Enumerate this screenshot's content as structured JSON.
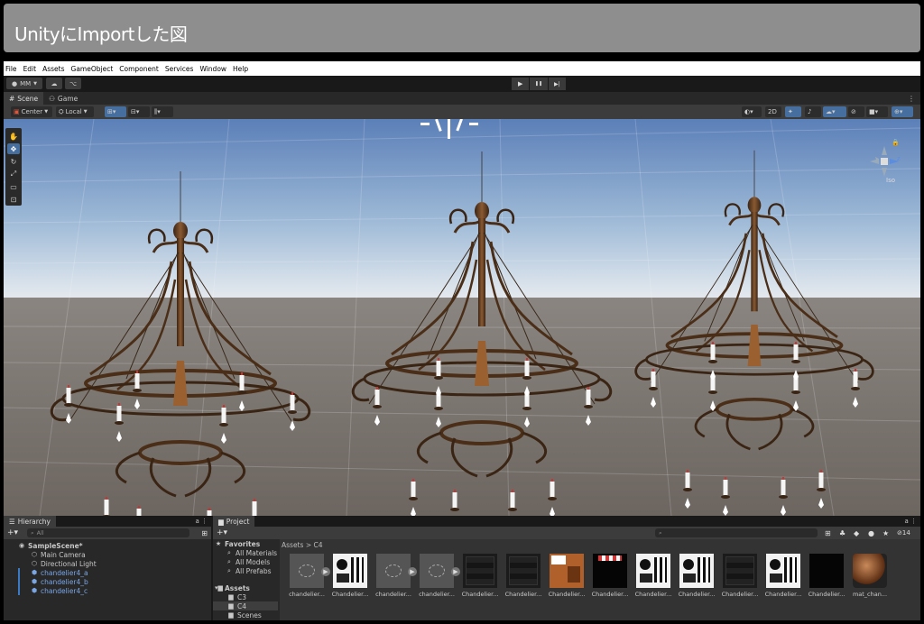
{
  "banner": {
    "title": "UnityにImportした図"
  },
  "menu": [
    "File",
    "Edit",
    "Assets",
    "GameObject",
    "Component",
    "Services",
    "Window",
    "Help"
  ],
  "toolbar": {
    "account": "MM",
    "play_icon": "▶",
    "pause_icon": "❚❚",
    "step_icon": "▶|"
  },
  "scene_tabs": [
    "Scene",
    "Game"
  ],
  "scene_bar": {
    "pivot": "Center",
    "space": "Local",
    "mode_2d": "2D"
  },
  "gizmo": {
    "view": "Iso",
    "axis_z": "z"
  },
  "hierarchy": {
    "tab": "Hierarchy",
    "search_placeholder": "All",
    "items": [
      {
        "label": "SampleScene*",
        "indent": 0,
        "icon": "scene-icon",
        "selected": false
      },
      {
        "label": "Main Camera",
        "indent": 1,
        "icon": "gameobject-icon",
        "selected": false
      },
      {
        "label": "Directional Light",
        "indent": 1,
        "icon": "gameobject-icon",
        "selected": false
      },
      {
        "label": "chandelier4_a",
        "indent": 1,
        "icon": "prefab-icon",
        "selected": true
      },
      {
        "label": "chandelier4_b",
        "indent": 1,
        "icon": "prefab-icon",
        "selected": true
      },
      {
        "label": "chandelier4_c",
        "indent": 1,
        "icon": "prefab-icon",
        "selected": true
      }
    ]
  },
  "project": {
    "tab": "Project",
    "count": "14",
    "favorites": {
      "title": "Favorites",
      "items": [
        "All Materials",
        "All Models",
        "All Prefabs"
      ]
    },
    "assets": {
      "title": "Assets",
      "folders": [
        "C3",
        "C4",
        "Scenes"
      ]
    },
    "breadcrumb": [
      "Assets",
      ">",
      "C4"
    ],
    "thumbnails": [
      {
        "label": "chandelier...",
        "kind": "model"
      },
      {
        "label": "Chandelier...",
        "kind": "tex-white"
      },
      {
        "label": "chandelier...",
        "kind": "model"
      },
      {
        "label": "chandelier...",
        "kind": "model"
      },
      {
        "label": "Chandelier...",
        "kind": "tex-dark"
      },
      {
        "label": "Chandelier...",
        "kind": "tex-dark"
      },
      {
        "label": "Chandelier...",
        "kind": "tex-brown"
      },
      {
        "label": "Chandelier...",
        "kind": "tex-black-red"
      },
      {
        "label": "Chandelier...",
        "kind": "tex-white"
      },
      {
        "label": "Chandelier...",
        "kind": "tex-white"
      },
      {
        "label": "Chandelier...",
        "kind": "tex-dark"
      },
      {
        "label": "Chandelier...",
        "kind": "tex-white"
      },
      {
        "label": "Chandelier...",
        "kind": "tex-black"
      },
      {
        "label": "mat_chan...",
        "kind": "material"
      }
    ]
  }
}
